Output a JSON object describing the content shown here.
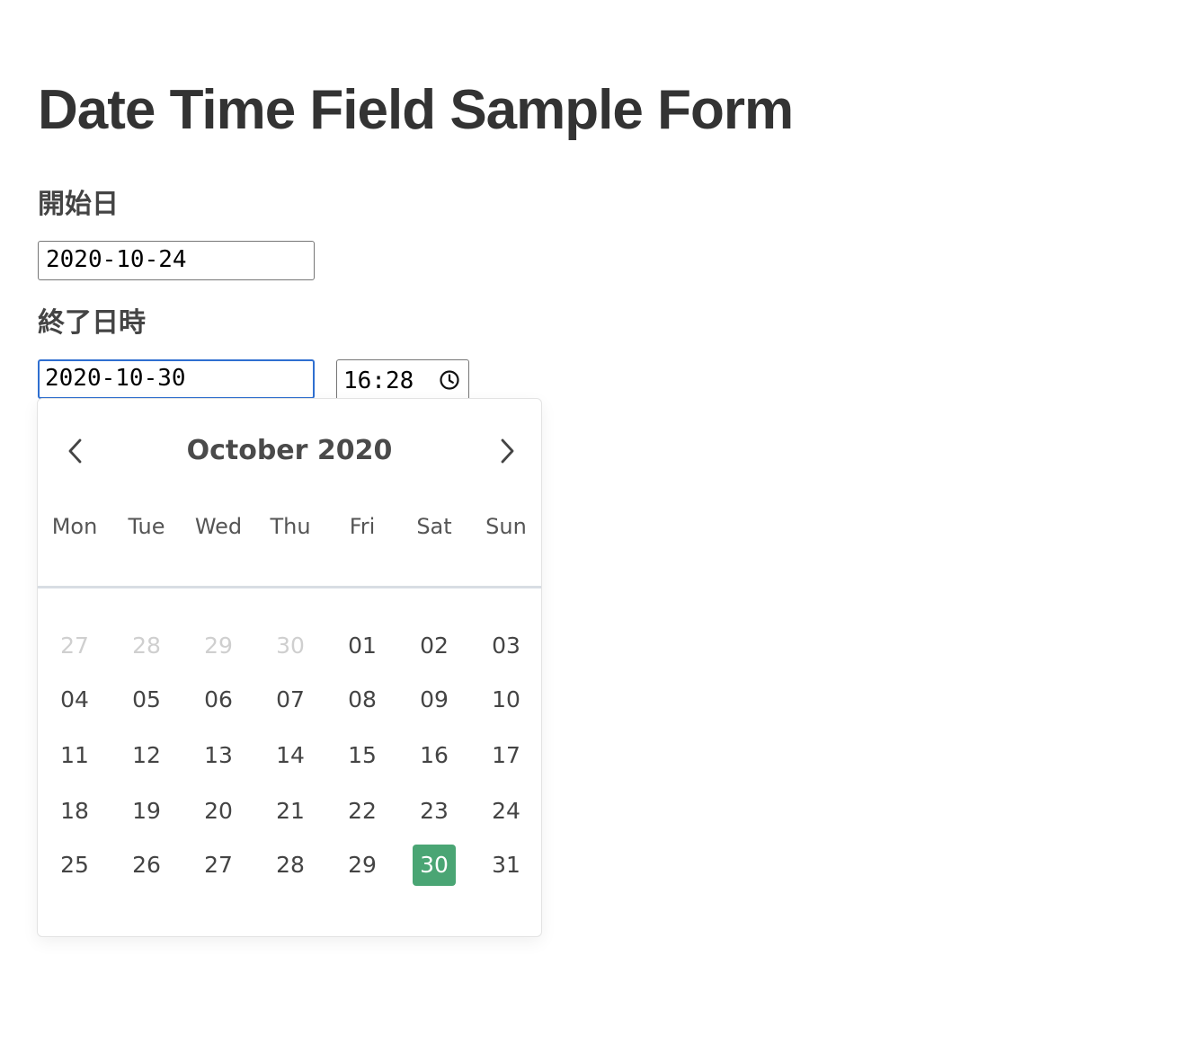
{
  "page": {
    "title": "Date Time Field Sample Form"
  },
  "form": {
    "start_label": "開始日",
    "start_value": "2020-10-24",
    "end_label": "終了日時",
    "end_date_value": "2020-10-30",
    "end_time_value": "16:28"
  },
  "calendar": {
    "month_label": "October 2020",
    "prev_icon": "chevron-left-icon",
    "next_icon": "chevron-right-icon",
    "weekdays": [
      "Mon",
      "Tue",
      "Wed",
      "Thu",
      "Fri",
      "Sat",
      "Sun"
    ],
    "weeks": [
      [
        {
          "label": "27",
          "outside": true
        },
        {
          "label": "28",
          "outside": true
        },
        {
          "label": "29",
          "outside": true
        },
        {
          "label": "30",
          "outside": true
        },
        {
          "label": "01",
          "outside": false
        },
        {
          "label": "02",
          "outside": false
        },
        {
          "label": "03",
          "outside": false
        }
      ],
      [
        {
          "label": "04",
          "outside": false
        },
        {
          "label": "05",
          "outside": false
        },
        {
          "label": "06",
          "outside": false
        },
        {
          "label": "07",
          "outside": false
        },
        {
          "label": "08",
          "outside": false
        },
        {
          "label": "09",
          "outside": false
        },
        {
          "label": "10",
          "outside": false
        }
      ],
      [
        {
          "label": "11",
          "outside": false
        },
        {
          "label": "12",
          "outside": false
        },
        {
          "label": "13",
          "outside": false
        },
        {
          "label": "14",
          "outside": false
        },
        {
          "label": "15",
          "outside": false
        },
        {
          "label": "16",
          "outside": false
        },
        {
          "label": "17",
          "outside": false
        }
      ],
      [
        {
          "label": "18",
          "outside": false
        },
        {
          "label": "19",
          "outside": false
        },
        {
          "label": "20",
          "outside": false
        },
        {
          "label": "21",
          "outside": false
        },
        {
          "label": "22",
          "outside": false
        },
        {
          "label": "23",
          "outside": false
        },
        {
          "label": "24",
          "outside": false
        }
      ],
      [
        {
          "label": "25",
          "outside": false
        },
        {
          "label": "26",
          "outside": false
        },
        {
          "label": "27",
          "outside": false
        },
        {
          "label": "28",
          "outside": false
        },
        {
          "label": "29",
          "outside": false
        },
        {
          "label": "30",
          "outside": false,
          "selected": true
        },
        {
          "label": "31",
          "outside": false
        }
      ]
    ]
  },
  "colors": {
    "selected_day_bg": "#4aa574",
    "focus_border": "#2f6fd0",
    "outside_day_text": "#cfcfcf"
  }
}
